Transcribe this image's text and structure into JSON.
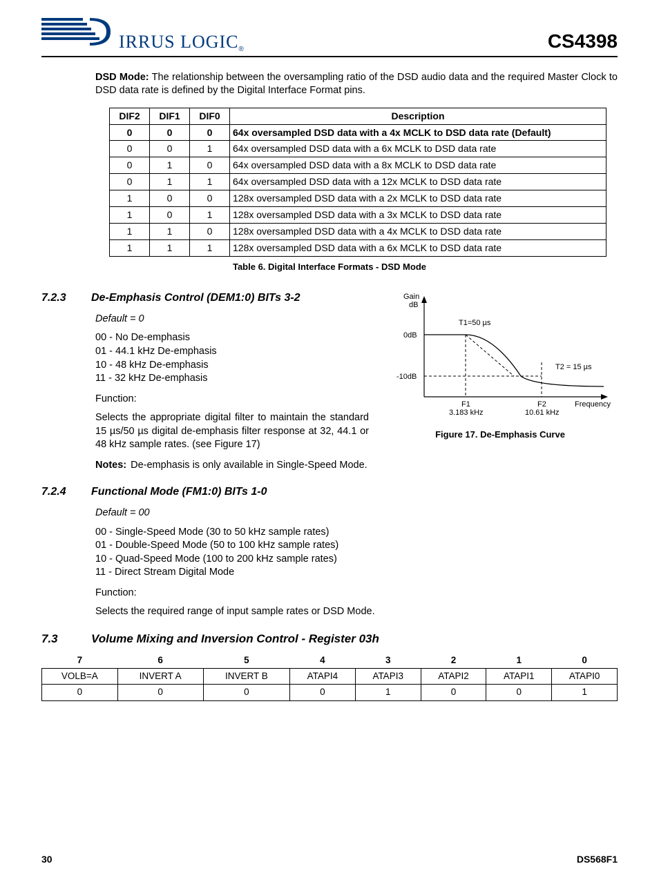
{
  "header": {
    "logo_text": "IRRUS LOGIC",
    "part_number": "CS4398"
  },
  "intro": {
    "bold_lead": "DSD Mode:",
    "text": " The relationship between the oversampling ratio of the DSD audio data and the required Master Clock to DSD data rate is defined by the Digital Interface Format pins."
  },
  "dif_table": {
    "headers": [
      "DIF2",
      "DIF1",
      "DIF0",
      "Description"
    ],
    "rows": [
      {
        "dif2": "0",
        "dif1": "0",
        "dif0": "0",
        "desc": "64x oversampled DSD data with a 4x MCLK to DSD data rate (Default)",
        "bold": true
      },
      {
        "dif2": "0",
        "dif1": "0",
        "dif0": "1",
        "desc": "64x oversampled DSD data with a 6x MCLK to DSD data rate",
        "bold": false
      },
      {
        "dif2": "0",
        "dif1": "1",
        "dif0": "0",
        "desc": "64x oversampled DSD data with a 8x MCLK to DSD data rate",
        "bold": false
      },
      {
        "dif2": "0",
        "dif1": "1",
        "dif0": "1",
        "desc": "64x oversampled DSD data with a 12x MCLK to DSD data rate",
        "bold": false
      },
      {
        "dif2": "1",
        "dif1": "0",
        "dif0": "0",
        "desc": "128x oversampled DSD data with a 2x MCLK to DSD data rate",
        "bold": false
      },
      {
        "dif2": "1",
        "dif1": "0",
        "dif0": "1",
        "desc": "128x oversampled DSD data with a 3x MCLK to DSD data rate",
        "bold": false
      },
      {
        "dif2": "1",
        "dif1": "1",
        "dif0": "0",
        "desc": "128x oversampled DSD data with a 4x MCLK to DSD data rate",
        "bold": false
      },
      {
        "dif2": "1",
        "dif1": "1",
        "dif0": "1",
        "desc": "128x oversampled DSD data with a 6x MCLK to DSD data rate",
        "bold": false
      }
    ],
    "caption": "Table 6. Digital Interface Formats - DSD Mode"
  },
  "sec_723": {
    "num": "7.2.3",
    "title": "De-Emphasis Control (DEM1:0) BITs 3-2",
    "default": "Default = 0",
    "lines": [
      "00 - No De-emphasis",
      "01 - 44.1 kHz De-emphasis",
      "10 - 48 kHz De-emphasis",
      "11 - 32 kHz De-emphasis"
    ],
    "func_label": "Function:",
    "func_text": "Selects the appropriate digital filter to maintain the standard 15 µs/50 µs digital de-emphasis filter response at 32, 44.1 or 48 kHz sample rates. (see Figure 17)",
    "notes_label": "Notes:",
    "notes_text": "De-emphasis is only available in Single-Speed Mode."
  },
  "figure17": {
    "caption": "Figure 17.  De-Emphasis Curve",
    "y_label": "Gain dB",
    "x_label": "Frequency",
    "tick_0db": "0dB",
    "tick_m10db": "-10dB",
    "t1": "T1=50 µs",
    "t2": "T2 = 15 µs",
    "f1": "F1",
    "f1_val": "3.183 kHz",
    "f2": "F2",
    "f2_val": "10.61 kHz"
  },
  "sec_724": {
    "num": "7.2.4",
    "title": "Functional Mode (FM1:0) BITs 1-0",
    "default": "Default = 00",
    "lines": [
      "00 - Single-Speed Mode (30 to 50 kHz sample rates)",
      "01 - Double-Speed Mode (50 to 100 kHz sample rates)",
      "10 - Quad-Speed Mode (100 to 200 kHz sample rates)",
      "11 - Direct Stream Digital Mode"
    ],
    "func_label": "Function:",
    "func_text": "Selects the required range of input sample rates or DSD Mode."
  },
  "sec_73": {
    "num": "7.3",
    "title": "Volume Mixing and Inversion Control - Register 03h",
    "bits": [
      "7",
      "6",
      "5",
      "4",
      "3",
      "2",
      "1",
      "0"
    ],
    "names": [
      "VOLB=A",
      "INVERT A",
      "INVERT B",
      "ATAPI4",
      "ATAPI3",
      "ATAPI2",
      "ATAPI1",
      "ATAPI0"
    ],
    "defaults": [
      "0",
      "0",
      "0",
      "0",
      "1",
      "0",
      "0",
      "1"
    ]
  },
  "footer": {
    "page": "30",
    "doc": "DS568F1"
  },
  "chart_data": {
    "type": "line",
    "title": "De-Emphasis Curve",
    "xlabel": "Frequency",
    "ylabel": "Gain dB",
    "series": [
      {
        "name": "Gain",
        "points": [
          {
            "x_label": "0",
            "y_db": 0
          },
          {
            "x_label": "F1 (3.183 kHz)",
            "y_db": 0
          },
          {
            "x_label": "F2 (10.61 kHz)",
            "y_db": -10
          },
          {
            "x_label": ">F2",
            "y_db": -10
          }
        ]
      }
    ],
    "annotations": {
      "T1": "50 µs",
      "T2": "15 µs"
    },
    "ylim": [
      -12,
      2
    ]
  }
}
